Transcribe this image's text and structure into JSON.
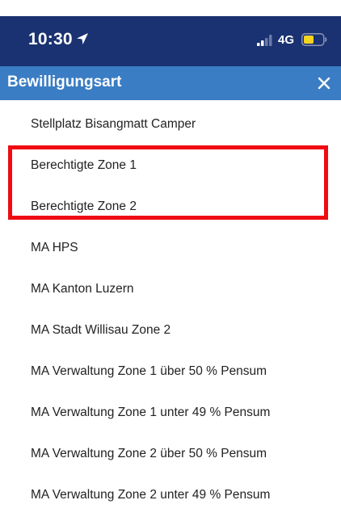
{
  "status_bar": {
    "time": "10:30",
    "network": "4G",
    "battery_color": "#f6d41f"
  },
  "header": {
    "title": "Bewilligungsart"
  },
  "list": {
    "items": [
      {
        "label": "Stellplatz Bisangmatt Camper"
      },
      {
        "label": "Berechtigte Zone 1"
      },
      {
        "label": "Berechtigte Zone 2"
      },
      {
        "label": "MA HPS"
      },
      {
        "label": "MA Kanton Luzern"
      },
      {
        "label": "MA Stadt Willisau Zone 2"
      },
      {
        "label": "MA Verwaltung Zone 1 über 50 % Pensum"
      },
      {
        "label": "MA Verwaltung Zone 1 unter 49 % Pensum"
      },
      {
        "label": "MA Verwaltung Zone 2 über 50 % Pensum"
      },
      {
        "label": "MA Verwaltung Zone 2 unter 49 % Pensum"
      }
    ]
  },
  "colors": {
    "status_bar_bg": "#1a3271",
    "header_bg": "#3a7dc4",
    "highlight": "#ee0c12"
  }
}
